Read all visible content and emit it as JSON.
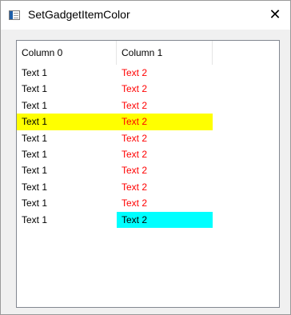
{
  "window": {
    "title": "SetGadgetItemColor",
    "close_label": "✕"
  },
  "listview": {
    "columns": [
      "Column 0",
      "Column 1"
    ],
    "rows": [
      {
        "cells": [
          "Text 1",
          "Text 2"
        ],
        "colors": [
          "#000000",
          "#ff0000"
        ],
        "backgrounds": [
          "",
          ""
        ]
      },
      {
        "cells": [
          "Text 1",
          "Text 2"
        ],
        "colors": [
          "#000000",
          "#ff0000"
        ],
        "backgrounds": [
          "",
          ""
        ]
      },
      {
        "cells": [
          "Text 1",
          "Text 2"
        ],
        "colors": [
          "#000000",
          "#ff0000"
        ],
        "backgrounds": [
          "",
          ""
        ]
      },
      {
        "cells": [
          "Text 1",
          "Text 2"
        ],
        "colors": [
          "#000000",
          "#ff0000"
        ],
        "backgrounds": [
          "#ffff00",
          "#ffff00"
        ]
      },
      {
        "cells": [
          "Text 1",
          "Text 2"
        ],
        "colors": [
          "#000000",
          "#ff0000"
        ],
        "backgrounds": [
          "",
          ""
        ]
      },
      {
        "cells": [
          "Text 1",
          "Text 2"
        ],
        "colors": [
          "#000000",
          "#ff0000"
        ],
        "backgrounds": [
          "",
          ""
        ]
      },
      {
        "cells": [
          "Text 1",
          "Text 2"
        ],
        "colors": [
          "#000000",
          "#ff0000"
        ],
        "backgrounds": [
          "",
          ""
        ]
      },
      {
        "cells": [
          "Text 1",
          "Text 2"
        ],
        "colors": [
          "#000000",
          "#ff0000"
        ],
        "backgrounds": [
          "",
          ""
        ]
      },
      {
        "cells": [
          "Text 1",
          "Text 2"
        ],
        "colors": [
          "#000000",
          "#ff0000"
        ],
        "backgrounds": [
          "",
          ""
        ]
      },
      {
        "cells": [
          "Text 1",
          "Text 2"
        ],
        "colors": [
          "#000000",
          "#000000"
        ],
        "backgrounds": [
          "",
          "#00ffff"
        ]
      }
    ]
  }
}
